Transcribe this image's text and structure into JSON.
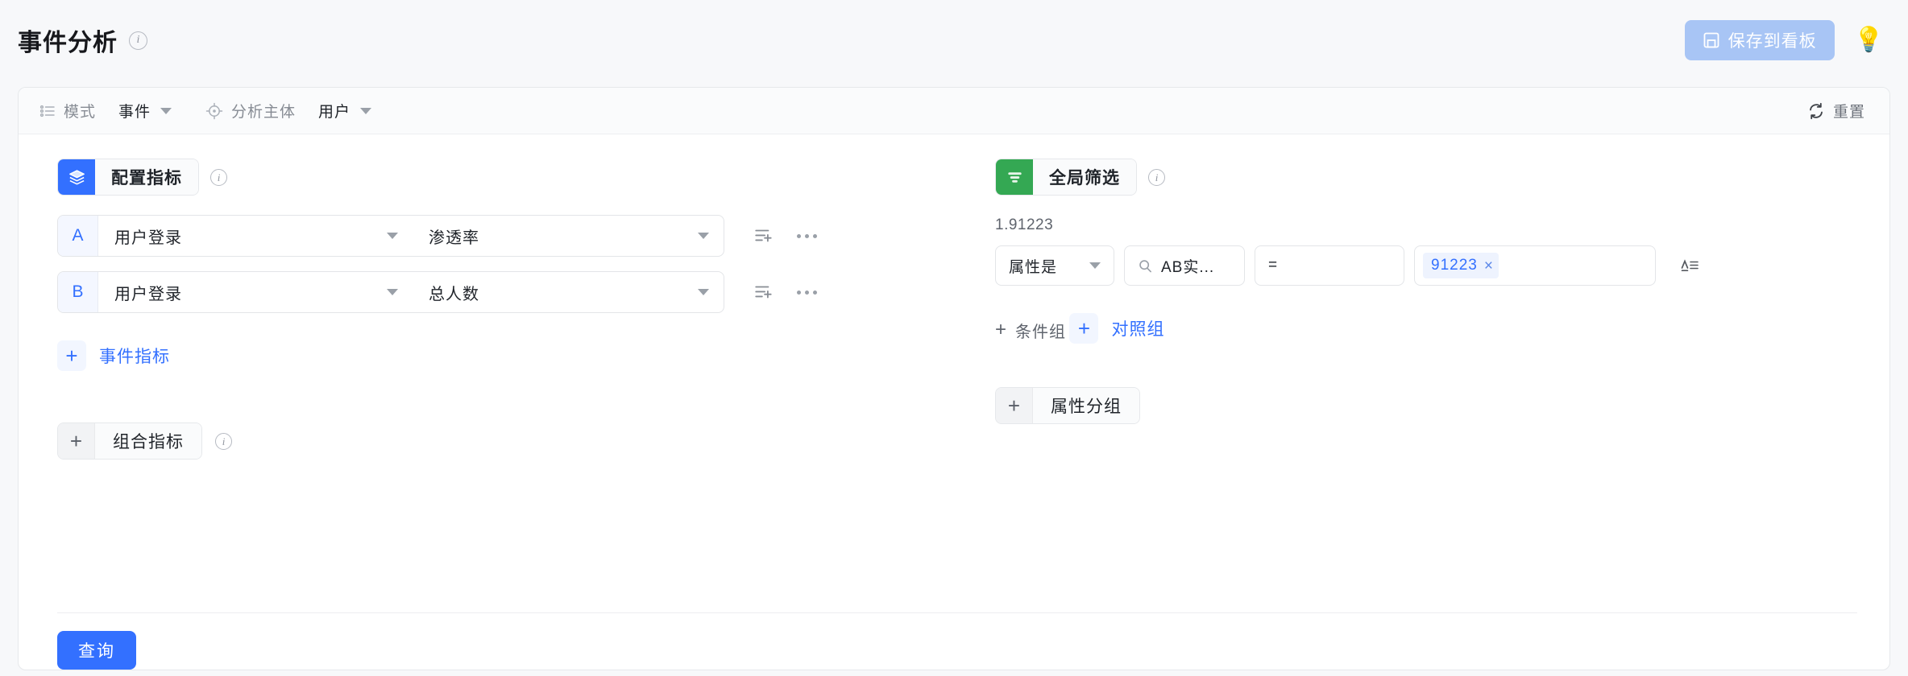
{
  "header": {
    "title": "事件分析",
    "info_icon": "info-circle-icon",
    "save_button": {
      "label": "保存到看板",
      "icon": "floppy-save-icon",
      "bg_color": "#a8c5f5"
    },
    "bulb_icon": "💡"
  },
  "toolbar": {
    "mode_icon": "ordered-list-icon",
    "mode_label": "模式",
    "mode_value": "事件",
    "subject_icon": "crosshair-target-icon",
    "subject_label": "分析主体",
    "subject_value": "用户",
    "reset_icon": "refresh-icon",
    "reset_label": "重置"
  },
  "metrics_panel": {
    "chip": {
      "label": "配置指标",
      "icon": "layers-stack-icon",
      "badge_color": "#3370ff"
    },
    "info_icon": "info-circle-icon",
    "rows": [
      {
        "letter": "A",
        "event": "用户登录",
        "measure": "渗透率",
        "filter_icon": "filter-add-icon",
        "more_icon": "more-horizontal-icon"
      },
      {
        "letter": "B",
        "event": "用户登录",
        "measure": "总人数",
        "filter_icon": "filter-add-icon",
        "more_icon": "more-horizontal-icon"
      }
    ],
    "add_event_metric": {
      "plus": "+",
      "label": "事件指标"
    },
    "composite_metric": {
      "plus": "+",
      "label": "组合指标",
      "info_icon": "info-circle-icon"
    }
  },
  "filter_panel": {
    "chip": {
      "label": "全局筛选",
      "icon": "filter-lines-icon",
      "badge_color": "#34a853"
    },
    "info_icon": "info-circle-icon",
    "caption": "1.91223",
    "condition": {
      "attribute_mode": "属性是",
      "search_icon": "search-icon",
      "property": "AB实...",
      "operator": "=",
      "value_tag": "91223",
      "tag_remove_icon": "×",
      "text_format_icon": "text-format-icon"
    },
    "add_condition_group": {
      "plus": "+",
      "label": "条件组"
    },
    "add_control_group": {
      "plus": "+",
      "label": "对照组"
    },
    "property_group": {
      "plus": "+",
      "label": "属性分组"
    }
  },
  "footer": {
    "query_label": "查询",
    "query_color": "#3370ff"
  }
}
